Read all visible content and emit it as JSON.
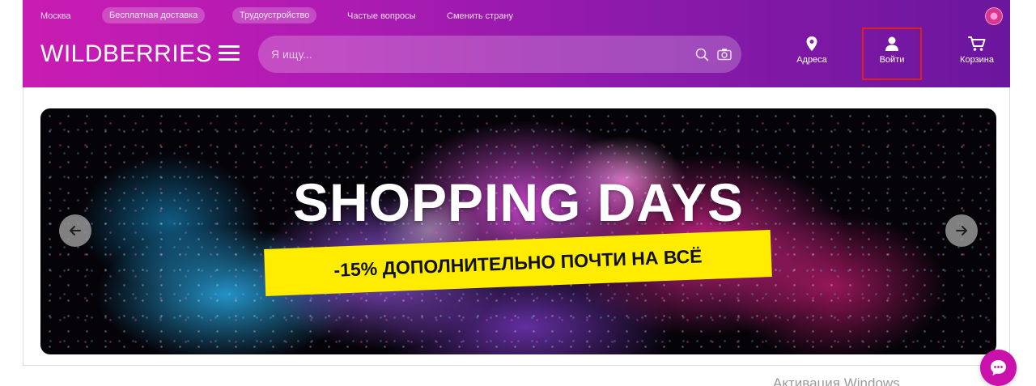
{
  "topbar": {
    "city": "Москва",
    "free_delivery": "Бесплатная доставка",
    "employment": "Трудоустройство",
    "faq": "Частые вопросы",
    "change_country": "Сменить страну"
  },
  "header": {
    "logo": "WILDBERRIES",
    "search_placeholder": "Я ищу...",
    "address_label": "Адреса",
    "login_label": "Войти",
    "cart_label": "Корзина"
  },
  "banner": {
    "title": "SHOPPING DAYS",
    "subtitle": "-15% ДОПОЛНИТЕЛЬНО ПОЧТИ НА ВСЁ"
  },
  "watermark": "Активация Windows",
  "icons": [
    "menu-icon",
    "search-icon",
    "camera-icon",
    "location-pin-icon",
    "user-icon",
    "cart-icon",
    "arrow-left-icon",
    "arrow-right-icon",
    "chat-icon",
    "country-flag-icon"
  ],
  "colors": {
    "header_start": "#c91cb2",
    "header_end": "#6b169e",
    "login_highlight": "#e02020",
    "banner_strip": "#ffec00",
    "chat_button": "#cb11ab"
  }
}
